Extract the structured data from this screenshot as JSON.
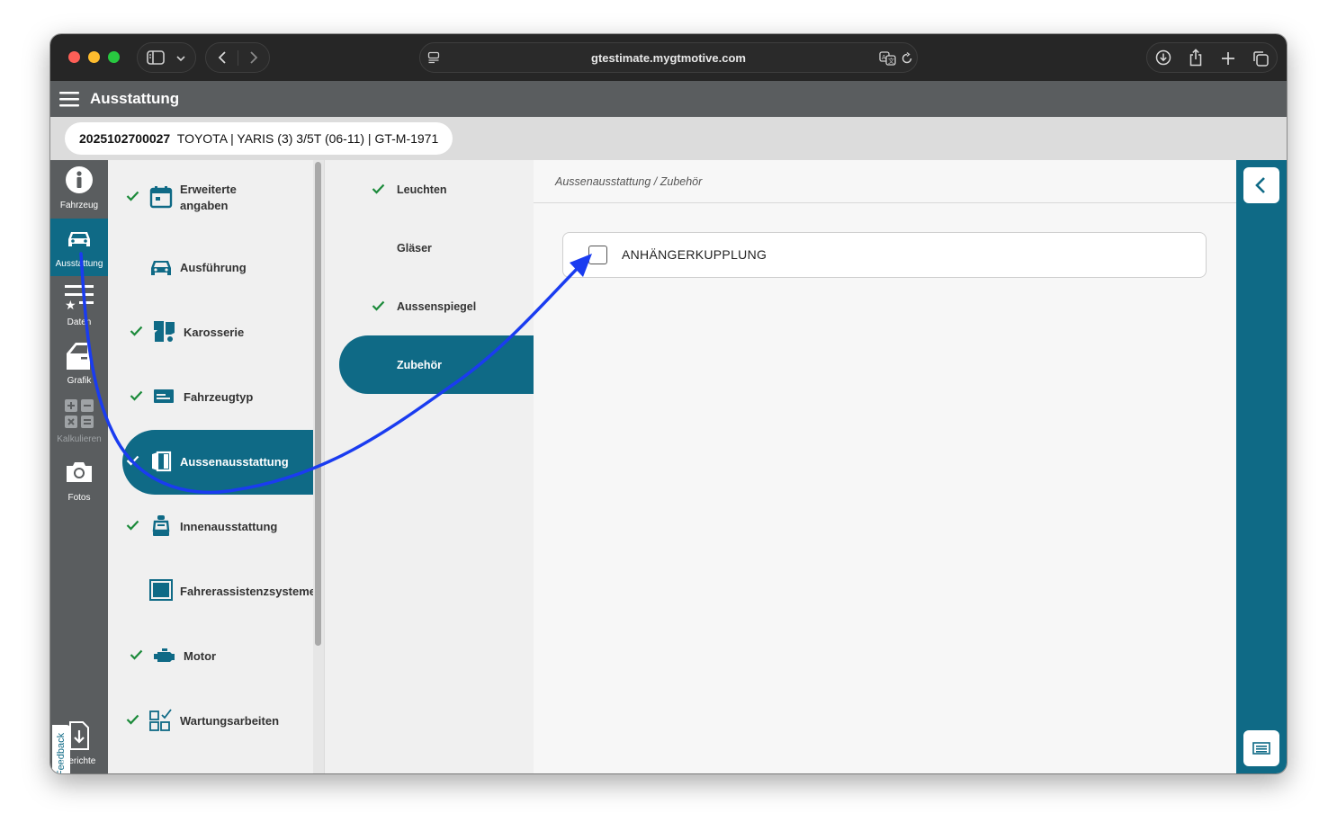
{
  "browser": {
    "url": "gtestimate.mygtmotive.com"
  },
  "app": {
    "title": "Ausstattung"
  },
  "vehicle": {
    "id": "2025102700027",
    "description": "TOYOTA | YARIS (3) 3/5T (06-11) | GT-M-1971"
  },
  "rail": {
    "items": [
      {
        "label": "Fahrzeug",
        "icon": "info-icon"
      },
      {
        "label": "Ausstattung",
        "icon": "car-icon",
        "active": true
      },
      {
        "label": "Daten",
        "icon": "list-star-icon"
      },
      {
        "label": "Grafik",
        "icon": "door-icon"
      },
      {
        "label": "Kalkulieren",
        "icon": "calculator-icon",
        "disabled": true
      },
      {
        "label": "Fotos",
        "icon": "camera-icon"
      }
    ],
    "feedback": "Feedback",
    "reports": "Berichte"
  },
  "categories": [
    {
      "label": "Erweiterte\nangaben",
      "checked": true,
      "icon": "calendar-icon"
    },
    {
      "label": "Ausführung",
      "checked": false,
      "icon": "car-front-icon"
    },
    {
      "label": "Karosserie",
      "checked": true,
      "icon": "body-icon"
    },
    {
      "label": "Fahrzeugtyp",
      "checked": true,
      "icon": "card-icon"
    },
    {
      "label": "Aussenausstattung",
      "checked": true,
      "icon": "door-panel-icon",
      "active": true
    },
    {
      "label": "Innenausstattung",
      "checked": true,
      "icon": "seat-icon"
    },
    {
      "label": "Fahrerassistenzsysteme",
      "checked": false,
      "icon": "screen-icon"
    },
    {
      "label": "Motor",
      "checked": true,
      "icon": "engine-icon"
    },
    {
      "label": "Wartungsarbeiten",
      "checked": true,
      "icon": "grid-check-icon"
    }
  ],
  "subcategories": [
    {
      "label": "Leuchten",
      "checked": true
    },
    {
      "label": "Gläser",
      "checked": false
    },
    {
      "label": "Aussenspiegel",
      "checked": true
    },
    {
      "label": "Zubehör",
      "checked": false,
      "active": true
    }
  ],
  "main": {
    "breadcrumb": "Aussenausstattung / Zubehör",
    "options": [
      {
        "label": "ANHÄNGERKUPPLUNG",
        "checked": false
      }
    ]
  },
  "colors": {
    "accent": "#0f6a86",
    "check": "#1b8a3a",
    "arrow": "#1a3cf0"
  }
}
